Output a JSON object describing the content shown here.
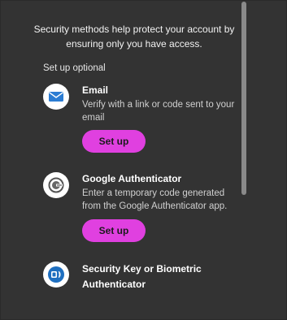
{
  "intro_text": "Security methods help protect your account by ensuring only you have access.",
  "section_label": "Set up optional",
  "methods": [
    {
      "title": "Email",
      "description": "Verify with a link or code sent to your email",
      "button_label": "Set up",
      "icon": "envelope-icon"
    },
    {
      "title": "Google Authenticator",
      "description": "Enter a temporary code generated from the Google Authenticator app.",
      "button_label": "Set up",
      "icon": "google-authenticator-icon"
    },
    {
      "title": "Security Key or Biometric Authenticator",
      "description": "",
      "icon": "biometric-key-icon"
    }
  ],
  "colors": {
    "background": "#333333",
    "button": "#e040e0",
    "email_icon": "#2b7cd3",
    "biometric_icon": "#1e6fc0"
  }
}
